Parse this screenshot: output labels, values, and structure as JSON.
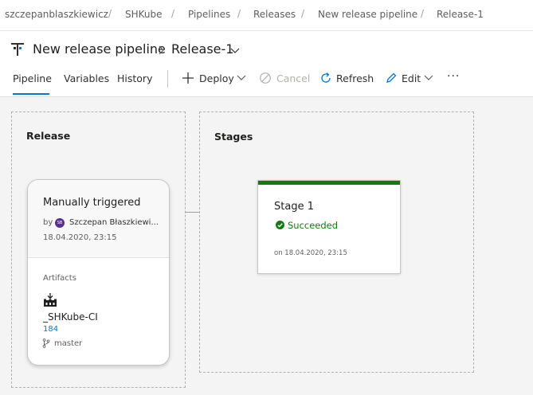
{
  "breadcrumb": {
    "items": [
      "szczepanblaszkiewicz",
      "SHKube",
      "Pipelines",
      "Releases",
      "New release pipeline",
      "Release-1"
    ],
    "separator": "/"
  },
  "header": {
    "pipeline_name": "New release pipeline",
    "release_name": "Release-1"
  },
  "tabs": [
    {
      "label": "Pipeline",
      "active": true
    },
    {
      "label": "Variables",
      "active": false
    },
    {
      "label": "History",
      "active": false
    }
  ],
  "toolbar": {
    "deploy_label": "Deploy",
    "cancel_label": "Cancel",
    "refresh_label": "Refresh",
    "edit_label": "Edit",
    "more_label": "···"
  },
  "release_section": {
    "title": "Release",
    "trigger": "Manually triggered",
    "by_label": "by",
    "user_initials": "SB",
    "user_name": "Szczepan Błaszkiewi...",
    "timestamp": "18.04.2020, 23:15",
    "artifacts_label": "Artifacts",
    "artifact": {
      "name": "_SHKube-CI",
      "build": "184",
      "branch": "master"
    }
  },
  "stages_section": {
    "title": "Stages",
    "stage": {
      "name": "Stage 1",
      "status": "Succeeded",
      "date": "on 18.04.2020, 23:15"
    }
  },
  "colors": {
    "accent": "#0078d4",
    "success": "#107c10",
    "avatar": "#5c2e91"
  }
}
